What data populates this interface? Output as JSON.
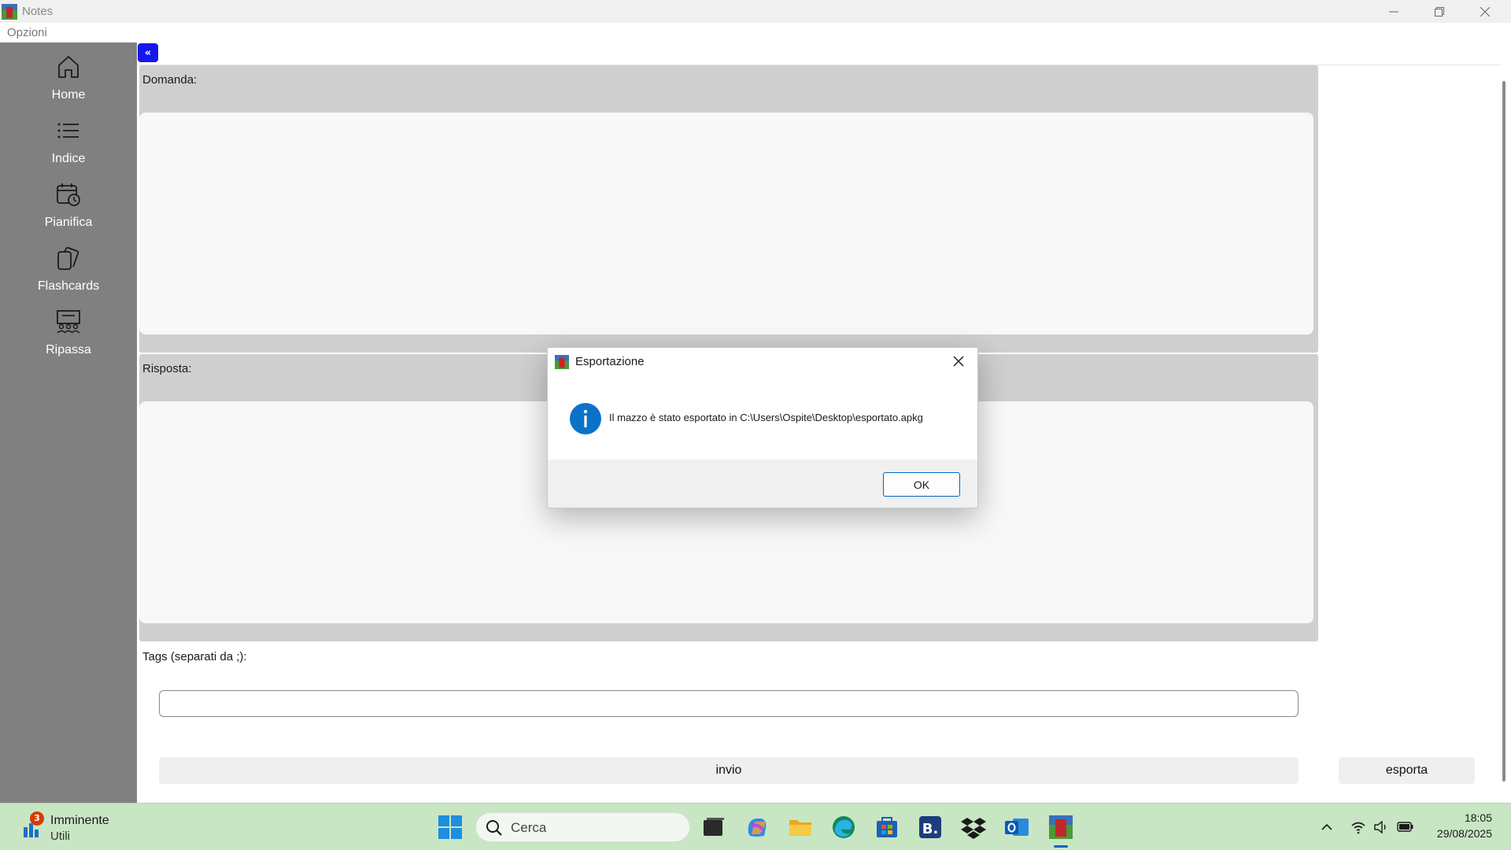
{
  "window": {
    "title": "Notes",
    "menu": [
      "Opzioni"
    ]
  },
  "sidebar": {
    "items": [
      {
        "label": "Home",
        "icon": "home-icon"
      },
      {
        "label": "Indice",
        "icon": "list-icon"
      },
      {
        "label": "Pianifica",
        "icon": "calendar-clock-icon"
      },
      {
        "label": "Flashcards",
        "icon": "cards-icon"
      },
      {
        "label": "Ripassa",
        "icon": "presentation-group-icon"
      }
    ]
  },
  "toolbar": {
    "collapse_label": "«"
  },
  "form": {
    "question_label": "Domanda:",
    "answer_label": "Risposta:",
    "tags_label": "Tags (separati da ;):",
    "tags_value": "",
    "submit_label": "invio",
    "export_label": "esporta"
  },
  "dialog": {
    "title": "Esportazione",
    "message": "Il mazzo è stato esportato in C:\\Users\\Ospite\\Desktop\\esportato.apkg",
    "ok_label": "OK"
  },
  "taskbar": {
    "widget_badge": "3",
    "widget_title": "Imminente",
    "widget_subtitle": "Utili",
    "search_placeholder": "Cerca",
    "apps": [
      "start-icon",
      "search-icon",
      "task-view-icon",
      "copilot-icon",
      "file-explorer-icon",
      "edge-icon",
      "store-icon",
      "booking-icon",
      "dropbox-icon",
      "outlook-icon",
      "notes-app-icon"
    ],
    "time": "18:05",
    "date": "29/08/2025"
  },
  "colors": {
    "sidebar": "#808080",
    "accent": "#1616ef",
    "panel": "#cfcfcf",
    "taskbar": "#c8e6c3",
    "info": "#0067c0"
  }
}
